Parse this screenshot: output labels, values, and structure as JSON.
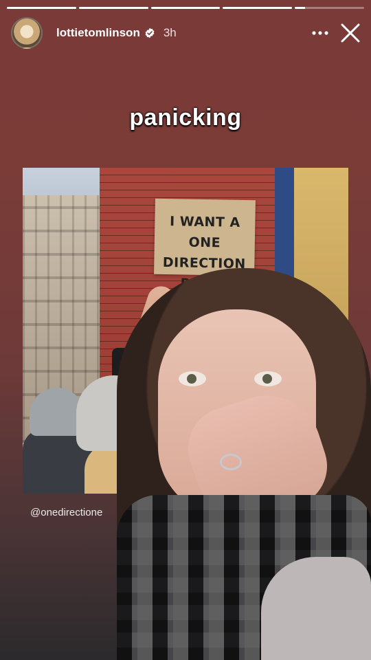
{
  "story": {
    "segments": [
      {
        "fill": 1.0
      },
      {
        "fill": 1.0
      },
      {
        "fill": 1.0
      },
      {
        "fill": 1.0
      },
      {
        "fill": 0.15
      }
    ],
    "user": {
      "username": "lottietomlinson",
      "verified": true,
      "time": "3h"
    },
    "caption": "panicking",
    "shared_post": {
      "sign_lines": [
        "I WANT A",
        "ONE DIRECTION",
        "REUNI"
      ],
      "credit": "@onedirectione"
    },
    "icons": {
      "more": "more-options-icon",
      "close": "close-icon",
      "verified": "verified-badge-icon"
    },
    "colors": {
      "background_top": "#7a3a37",
      "background_bottom": "#2b2a2c",
      "verified_badge": "#ffffff"
    }
  }
}
